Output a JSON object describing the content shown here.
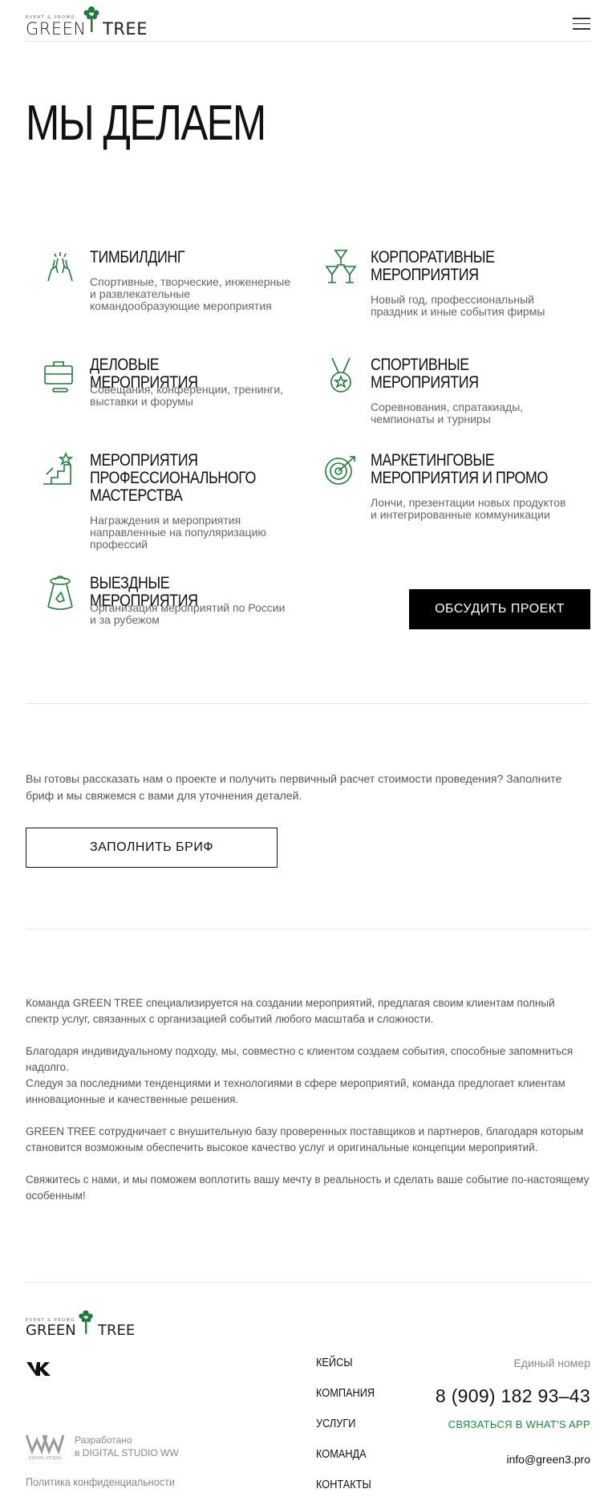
{
  "brand": {
    "tagline": "EVENT & PROMO",
    "word1": "GREEN",
    "word2": "TREE",
    "accent": "#1f7a3a"
  },
  "header": {
    "menu_icon": "hamburger-icon"
  },
  "heading": "МЫ ДЕЛАЕМ",
  "services": [
    {
      "title": "ТИМБИЛДИНГ",
      "desc": "Спортивные, творческие, инженерные и развлекательные командообразующие мероприятия",
      "icon": "hands-icon"
    },
    {
      "title": "КОРПОРАТИВНЫЕ\nМЕРОПРИЯТИЯ",
      "desc": "Новый год, профессиональный праздник и иные события фирмы",
      "icon": "glasses-icon"
    },
    {
      "title": "ДЕЛОВЫЕ МЕРОПРИЯТИЯ",
      "desc": "Совещания, конференции, тренинги, выставки и форумы",
      "icon": "briefcase-icon"
    },
    {
      "title": "СПОРТИВНЫЕ\nМЕРОПРИЯТИЯ",
      "desc": "Соревнования, спратакиады, чемпионаты и турниры",
      "icon": "medal-icon"
    },
    {
      "title": "МЕРОПРИЯТИЯ\nПРОФЕССИОНАЛЬНОГО\nМАСТЕРСТВА",
      "desc": "Награждения и мероприятия направленные на популяризацию профессий",
      "icon": "podium-icon"
    },
    {
      "title": "МАРКЕТИНГОВЫЕ\nМЕРОПРИЯТИЯ И ПРОМО",
      "desc": "Лончи, презентации новых продуктов и интегрированные коммуникации",
      "icon": "target-icon"
    },
    {
      "title": "ВЫЕЗДНЫЕ МЕРОПРИЯТИЯ",
      "desc": "Организация мероприятий по России и за рубежом",
      "icon": "ufo-icon"
    }
  ],
  "discuss_button": "ОБСУДИТЬ ПРОЕКТ",
  "brief": {
    "text": "Вы готовы рассказать нам о проекте и получить первичный расчет стоимости проведения? Заполните бриф и мы свяжемся с вами для уточнения деталей.",
    "button": "ЗАПОЛНИТЬ БРИФ"
  },
  "about": {
    "p1": "Команда GREEN TREE специализируется на создании мероприятий, предлагая своим клиентам полный спектр услуг, связанных с организацией событий  любого масштаба и сложности.",
    "p2a": "Благодаря индивидуальному подходу, мы, совместно с клиентом создаем события, способные запомниться надолго.",
    "p2b": "Следуя за последними тенденциями и технологиями в сфере мероприятий, команда предлогает клиентам инновационные и качественные решения.",
    "p3": "GREEN TREE сотрудничает с внушительную базу проверенных поставщиков и партнеров, благодаря которым становится возможным обеспечить высокое качество услуг и оригинальные концепции мероприятий.",
    "p4": "Свяжитесь с нами, и мы поможем воплотить вашу мечту в реальность и сделать ваше событие по-настоящему особенным!"
  },
  "footer": {
    "nav": [
      "КЕЙСЫ",
      "КОМПАНИЯ",
      "УСЛУГИ",
      "КОМАНДА",
      "КОНТАКТЫ"
    ],
    "phone_label": "Единый номер",
    "phone": "8 (909) 182 93–43",
    "whatsapp": "СВЯЗАТЬСЯ В WHAT'S APP",
    "email": "info@green3.pro",
    "dev_line1": "Разработано",
    "dev_line2": "в DIGITAL STUDIO WW",
    "dev_mark": "DIGITAL STUDIO",
    "policy": "Политика конфиденциальности"
  }
}
